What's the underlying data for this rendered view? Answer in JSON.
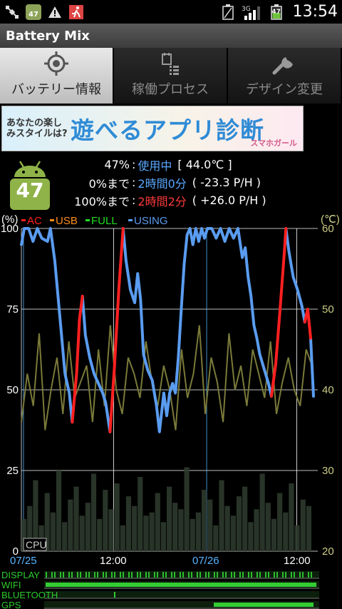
{
  "status_bar": {
    "left_icons": [
      "satellite-icon",
      "battery-widget-icon",
      "warning-icon",
      "running-person-icon"
    ],
    "battery_widget_text": "47",
    "right_icons": [
      "battery-empty-icon",
      "signal-3g-icon",
      "battery-level-icon"
    ],
    "network": "3G",
    "battery_icon_text": "47",
    "time": "13:54"
  },
  "app": {
    "title": "Battery Mix"
  },
  "tabs": [
    {
      "label": "バッテリー情報",
      "icon": "target-icon",
      "active": true
    },
    {
      "label": "稼働プロセス",
      "icon": "process-list-icon",
      "active": false
    },
    {
      "label": "デザイン変更",
      "icon": "wrench-icon",
      "active": false
    }
  ],
  "banner": {
    "question": "あなたの楽しみスタイルは?",
    "title": "遊べるアプリ診断",
    "sub": "スマホガール"
  },
  "battery": {
    "level_badge": "47",
    "line1": {
      "pct": "47%",
      "sep": ":",
      "status": "使用中",
      "temp": "[ 44.0℃ ]"
    },
    "line2": {
      "pre": "0%まで",
      "sep": ":",
      "time": "2時間0分",
      "rate": "( -23.3 P/H )"
    },
    "line3": {
      "pre": "100%まで",
      "sep": ":",
      "time": "2時間2分",
      "rate": "( +26.0 P/H )"
    }
  },
  "graph": {
    "left_unit": "(%)",
    "right_unit": "(℃)",
    "legend": [
      {
        "label": "AC",
        "color": "#ff2020"
      },
      {
        "label": "USB",
        "color": "#ff8c1a"
      },
      {
        "label": "FULL",
        "color": "#22dd22"
      },
      {
        "label": "USING",
        "color": "#5a9cf0"
      }
    ],
    "y_left_ticks": [
      "100",
      "75",
      "50",
      "25",
      "0"
    ],
    "y_right_ticks": [
      "60",
      "50",
      "40",
      "30",
      "20"
    ],
    "x_ticks": [
      {
        "label": "07/25",
        "color": "#5ab4ff"
      },
      {
        "label": "12:00",
        "color": "#ffffff"
      },
      {
        "label": "07/26",
        "color": "#5ab4ff"
      },
      {
        "label": "12:00",
        "color": "#ffffff"
      }
    ],
    "cpu_label": "CPU",
    "lanes": [
      "DISPLAY",
      "WIFI",
      "BLUETOOTH",
      "GPS"
    ]
  },
  "chart_data": {
    "type": "line",
    "ylabel_left": "(%)",
    "ylabel_right": "(℃)",
    "ylim_left": [
      0,
      100
    ],
    "ylim_right": [
      20,
      60
    ],
    "x_ticks": [
      "07/25",
      "12:00",
      "07/26",
      "12:00"
    ],
    "series": [
      {
        "name": "USING",
        "color": "#5a9cf0",
        "segments": [
          [
            [
              0,
              95
            ],
            [
              2,
              100
            ],
            [
              5,
              100
            ],
            [
              8,
              96
            ],
            [
              11,
              100
            ],
            [
              14,
              97
            ],
            [
              18,
              96
            ],
            [
              20,
              100
            ],
            [
              23,
              90
            ],
            [
              27,
              70
            ],
            [
              30,
              55
            ],
            [
              33,
              49
            ],
            [
              35,
              40
            ]
          ],
          [
            [
              42,
              79
            ],
            [
              44,
              67
            ],
            [
              47,
              60
            ],
            [
              50,
              55
            ],
            [
              53,
              52
            ],
            [
              56,
              49
            ],
            [
              58,
              46
            ],
            [
              61,
              37
            ]
          ],
          [
            [
              70,
              100
            ],
            [
              72,
              90
            ],
            [
              75,
              81
            ],
            [
              78,
              77
            ],
            [
              80,
              86
            ],
            [
              82,
              78
            ],
            [
              84,
              61
            ],
            [
              87,
              56
            ],
            [
              90,
              53
            ],
            [
              93,
              45
            ],
            [
              95,
              37
            ],
            [
              98,
              49
            ],
            [
              100,
              42
            ],
            [
              102,
              49
            ],
            [
              104,
              52
            ],
            [
              106,
              49
            ],
            [
              108,
              60
            ],
            [
              110,
              75
            ],
            [
              112,
              89
            ],
            [
              114,
              98
            ],
            [
              116,
              100
            ],
            [
              118,
              95
            ],
            [
              120,
              100
            ],
            [
              122,
              96
            ],
            [
              124,
              100
            ],
            [
              126,
              97
            ],
            [
              128,
              100
            ],
            [
              131,
              100
            ],
            [
              134,
              97
            ],
            [
              137,
              100
            ],
            [
              140,
              96
            ],
            [
              143,
              100
            ],
            [
              146,
              97
            ],
            [
              149,
              100
            ],
            [
              152,
              91
            ],
            [
              154,
              94
            ],
            [
              156,
              85
            ],
            [
              158,
              79
            ],
            [
              160,
              70
            ],
            [
              162,
              66
            ],
            [
              164,
              61
            ],
            [
              166,
              58
            ],
            [
              168,
              55
            ],
            [
              170,
              52
            ],
            [
              172,
              48
            ]
          ],
          [
            [
              182,
              100
            ],
            [
              184,
              93
            ],
            [
              187,
              85
            ],
            [
              190,
              81
            ],
            [
              193,
              76
            ],
            [
              195,
              71
            ]
          ],
          [
            [
              199,
              66
            ],
            [
              201,
              48
            ]
          ]
        ]
      },
      {
        "name": "AC",
        "color": "#ff2020",
        "segments": [
          [
            [
              35,
              40
            ],
            [
              38,
              55
            ],
            [
              40,
              72
            ],
            [
              42,
              79
            ]
          ],
          [
            [
              61,
              37
            ],
            [
              64,
              57
            ],
            [
              67,
              81
            ],
            [
              70,
              100
            ]
          ],
          [
            [
              172,
              48
            ],
            [
              175,
              58
            ],
            [
              178,
              75
            ],
            [
              181,
              93
            ],
            [
              182,
              100
            ]
          ],
          [
            [
              195,
              71
            ],
            [
              197,
              75
            ],
            [
              199,
              66
            ]
          ]
        ]
      }
    ],
    "cpu_temperature_c": [
      36,
      42,
      38,
      47,
      35,
      40,
      44,
      37,
      46,
      39,
      41,
      43,
      36,
      45,
      38,
      48,
      40,
      37,
      44,
      42,
      39,
      46,
      41,
      38,
      43,
      40,
      35,
      45,
      39,
      42,
      48,
      37,
      44,
      41,
      36,
      47,
      40,
      43,
      38,
      45,
      42,
      39,
      46,
      37,
      41,
      44,
      40,
      38,
      45,
      43
    ],
    "cpu_usage_pct": [
      10,
      14,
      22,
      8,
      18,
      12,
      25,
      9,
      16,
      20,
      11,
      15,
      24,
      10,
      19,
      13,
      21,
      8,
      17,
      14,
      23,
      11,
      12,
      18,
      9,
      20,
      15,
      13,
      26,
      10,
      12,
      19,
      16,
      8,
      22,
      14,
      11,
      17,
      20,
      9,
      13,
      24,
      15,
      10,
      18,
      12,
      21,
      8,
      16,
      14
    ]
  }
}
